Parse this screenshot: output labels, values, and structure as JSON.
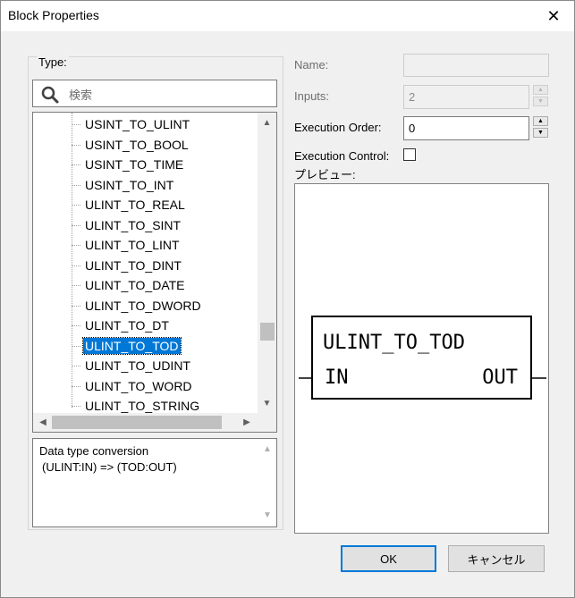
{
  "dialog": {
    "title": "Block Properties"
  },
  "type_group": {
    "label": "Type:",
    "search_placeholder": "検索",
    "items": [
      {
        "label": "USINT_TO_ULINT"
      },
      {
        "label": "USINT_TO_BOOL"
      },
      {
        "label": "USINT_TO_TIME"
      },
      {
        "label": "USINT_TO_INT"
      },
      {
        "label": "ULINT_TO_REAL"
      },
      {
        "label": "ULINT_TO_SINT"
      },
      {
        "label": "ULINT_TO_LINT"
      },
      {
        "label": "ULINT_TO_DINT"
      },
      {
        "label": "ULINT_TO_DATE"
      },
      {
        "label": "ULINT_TO_DWORD"
      },
      {
        "label": "ULINT_TO_DT"
      },
      {
        "label": "ULINT_TO_TOD"
      },
      {
        "label": "ULINT_TO_UDINT"
      },
      {
        "label": "ULINT_TO_WORD"
      },
      {
        "label": "ULINT_TO_STRING"
      }
    ],
    "selected": "ULINT_TO_TOD",
    "description_line1": "Data type conversion",
    "description_line2": "(ULINT:IN) => (TOD:OUT)"
  },
  "props": {
    "name_label": "Name:",
    "name_value": "",
    "inputs_label": "Inputs:",
    "inputs_value": "2",
    "exec_order_label": "Execution Order:",
    "exec_order_value": "0",
    "exec_control_label": "Execution Control:",
    "exec_control_checked": false,
    "preview_label": "プレビュー:"
  },
  "preview_block": {
    "name": "ULINT_TO_TOD",
    "input": "IN",
    "output": "OUT"
  },
  "buttons": {
    "ok": "OK",
    "cancel": "キャンセル"
  },
  "colors": {
    "selection": "#0078d7",
    "dialog_bg": "#f0f0f0"
  }
}
